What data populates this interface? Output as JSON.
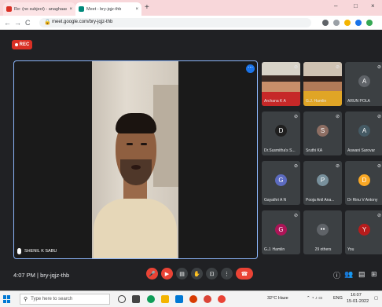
{
  "browser": {
    "tabs": [
      {
        "label": "Re: (no subject) - anaghaaswani@g",
        "close": "×",
        "favicon_color": "#d93025"
      },
      {
        "label": "Meet - bry-jqjz-thb",
        "close": "×",
        "favicon_color": "#00897b"
      }
    ],
    "new_tab": "+",
    "window_controls": [
      "–",
      "□",
      "×"
    ],
    "nav": {
      "back": "←",
      "forward": "→",
      "reload": "C"
    },
    "url": "meet.google.com/bry-jqjz-thb"
  },
  "meet": {
    "rec_label": "REC",
    "main_speaker": "SHENIL K SABU",
    "more_button": "⋯",
    "tiles": [
      {
        "name": "Archana K A",
        "kind": "photo"
      },
      {
        "name": "G.J. Hamlin",
        "kind": "photo"
      },
      {
        "name": "ARUN POLA",
        "kind": "avatar",
        "initial": "A",
        "color": "#5f6368"
      },
      {
        "name": "Dr.Susmitha's S...",
        "kind": "avatar",
        "initial": "D",
        "color": "#1f1f1f"
      },
      {
        "name": "Sruthi KA",
        "kind": "avatar",
        "initial": "S",
        "color": "#8d6e63"
      },
      {
        "name": "Aswani Sarovar",
        "kind": "avatar",
        "initial": "A",
        "color": "#455a64"
      },
      {
        "name": "Gayathri A N",
        "kind": "avatar",
        "initial": "G",
        "color": "#5c6bc0"
      },
      {
        "name": "Pooja Anil Ana...",
        "kind": "avatar",
        "initial": "P",
        "color": "#78909c"
      },
      {
        "name": "Dr Rinu V Antony",
        "kind": "avatar",
        "initial": "D",
        "color": "#f9a825"
      },
      {
        "name": "G.J. Hamlin",
        "kind": "avatar",
        "initial": "G",
        "color": "#ad1457"
      },
      {
        "name": "29 others",
        "kind": "others",
        "initial": "29",
        "color": "#3c4043"
      },
      {
        "name": "You",
        "kind": "avatar",
        "initial": "Y",
        "color": "#b71c1c"
      }
    ],
    "time": "4:07 PM",
    "separator": "|",
    "meeting_code": "bry-jqjz-thb",
    "controls": {
      "mic": "🎤",
      "cam": "▶",
      "captions": "▤",
      "hand": "✋",
      "present": "⊡",
      "more": "⋮",
      "leave": "☎"
    },
    "right_controls": {
      "info": "ⓘ",
      "people": "👥",
      "chat": "▤",
      "activities": "⊞"
    },
    "people_count": "42"
  },
  "taskbar": {
    "search_placeholder": "Type here to search",
    "weather": "32°C  Haze",
    "lang": "ENG",
    "clock_time": "16:07",
    "clock_date": "15-01-2022"
  }
}
